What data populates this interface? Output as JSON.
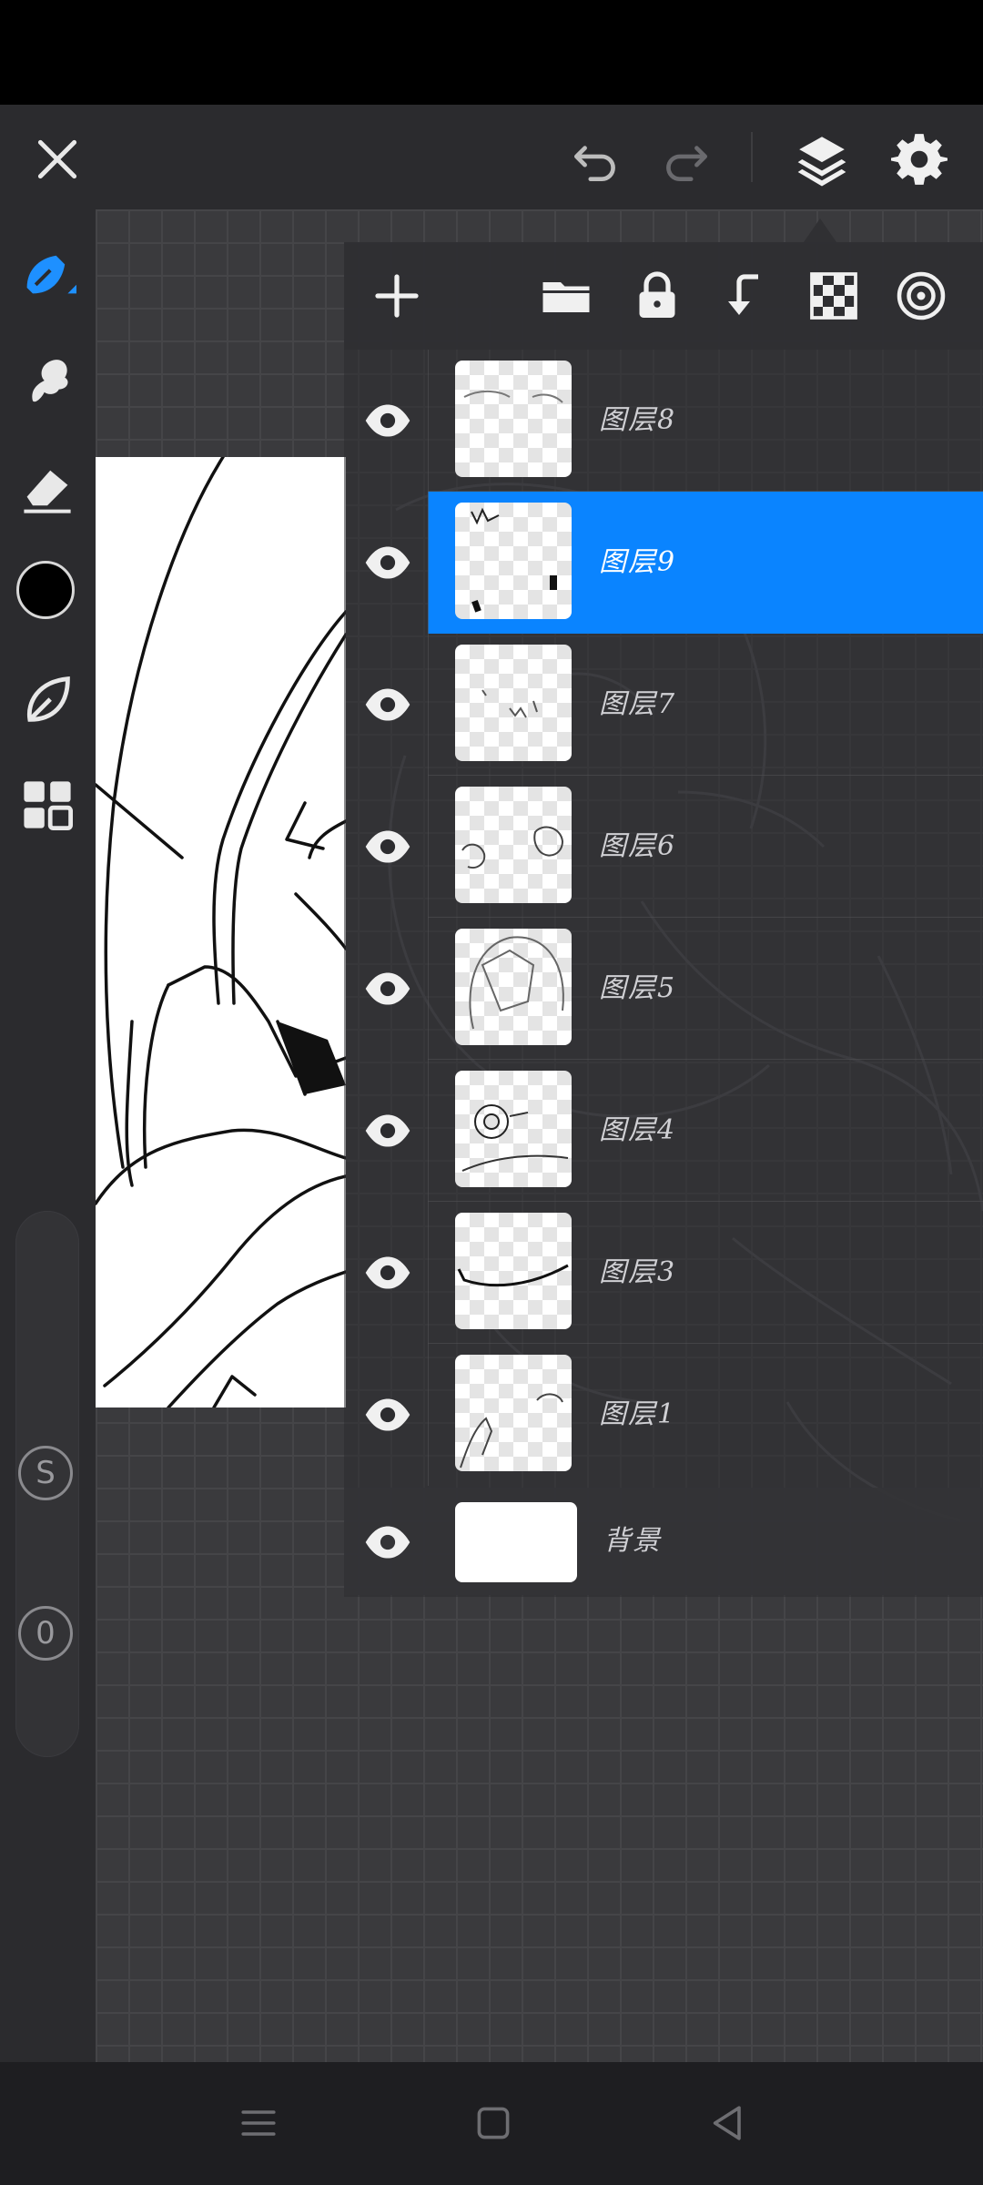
{
  "header": {
    "close_icon": "close-icon",
    "undo_icon": "undo-icon",
    "redo_icon": "redo-icon",
    "layers_icon": "layers-icon",
    "settings_icon": "gear-icon"
  },
  "toolbar": {
    "tools": [
      "pen-icon",
      "smudge-icon",
      "eraser-icon",
      "color-swatch",
      "leaf-icon",
      "grid-icon"
    ],
    "current_color": "#000000",
    "size_slider_label": "S",
    "opacity_slider_label": "0"
  },
  "layers_panel": {
    "actions": [
      "add-icon",
      "folder-icon",
      "lock-icon",
      "merge-down-icon",
      "checkerboard-icon",
      "target-icon"
    ],
    "layers": [
      {
        "name": "图层8",
        "selected": false
      },
      {
        "name": "图层9",
        "selected": true
      },
      {
        "name": "图层7",
        "selected": false
      },
      {
        "name": "图层6",
        "selected": false
      },
      {
        "name": "图层5",
        "selected": false
      },
      {
        "name": "图层4",
        "selected": false
      },
      {
        "name": "图层3",
        "selected": false
      },
      {
        "name": "图层1",
        "selected": false
      }
    ],
    "background_layer": "背景",
    "selected_color": "#0a84ff"
  },
  "nav": {
    "menu_icon": "menu-icon",
    "home_icon": "home-icon",
    "back_icon": "back-icon"
  }
}
